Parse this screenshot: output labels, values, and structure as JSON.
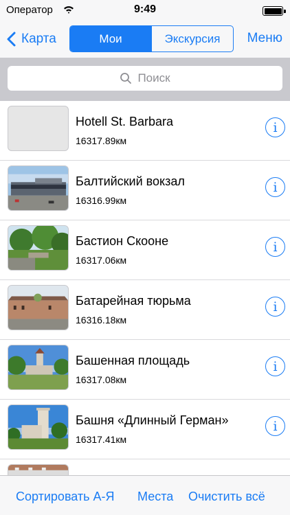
{
  "status_bar": {
    "carrier": "Оператор",
    "time": "9:49"
  },
  "nav": {
    "back_label": "Карта",
    "segments": [
      "Мои",
      "Экскурсия"
    ],
    "selected_segment": "Мои",
    "menu_label": "Меню"
  },
  "search": {
    "placeholder": "Поиск"
  },
  "items": [
    {
      "title": "Hotell St. Barbara",
      "distance": "16317.89км",
      "thumbnail": "placeholder"
    },
    {
      "title": "Балтийский вокзал",
      "distance": "16316.99км",
      "thumbnail": "station-photo"
    },
    {
      "title": "Бастион Скооне",
      "distance": "16317.06км",
      "thumbnail": "park-photo"
    },
    {
      "title": "Батарейная тюрьма",
      "distance": "16316.18км",
      "thumbnail": "prison-photo"
    },
    {
      "title": "Башенная площадь",
      "distance": "16317.08км",
      "thumbnail": "towers-photo"
    },
    {
      "title": "Башня «Длинный Герман»",
      "distance": "16317.41км",
      "thumbnail": "tower-photo"
    }
  ],
  "info_button_label": "i",
  "toolbar": {
    "sort_label": "Сортировать А-Я",
    "places_label": "Места",
    "clear_label": "Очистить всё"
  },
  "colors": {
    "accent": "#1a7cf4",
    "search_bg": "#c9c9ce",
    "bar_bg": "#f7f7f8"
  }
}
